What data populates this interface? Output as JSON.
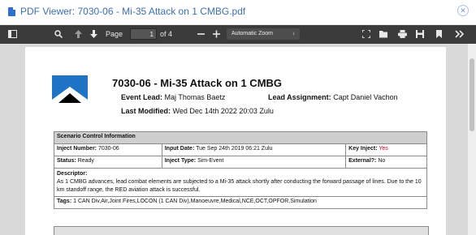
{
  "window": {
    "title": "PDF Viewer: 7030-06 - Mi-35 Attack on 1 CMBG.pdf"
  },
  "toolbar": {
    "page_label": "Page",
    "page_value": "1",
    "page_of": "of 4",
    "zoom_value": "Automatic Zoom",
    "zoom_caret": "↕",
    "icons": [
      "sidebar-toggle-icon",
      "search-icon",
      "previous-page-icon",
      "next-page-icon",
      "zoom-out-icon",
      "zoom-in-icon",
      "presentation-mode-icon",
      "open-file-icon",
      "print-icon",
      "save-icon",
      "bookmark-icon",
      "tools-icon"
    ]
  },
  "document": {
    "title": "7030-06 - Mi-35 Attack on 1 CMBG",
    "event_lead_label": "Event Lead:",
    "event_lead_value": "Maj Thomas Baetz",
    "lead_assignment_label": "Lead Assignment:",
    "lead_assignment_value": "Capt Daniel Vachon",
    "last_modified_label": "Last Modified:",
    "last_modified_value": "Wed Dec 14th 2022 20:03 Zulu",
    "scenario_control": {
      "heading": "Scenario Control Information",
      "inject_number_label": "Inject Number:",
      "inject_number_value": "7030-06",
      "input_date_label": "Input Date:",
      "input_date_value": "Tue Sep 24th 2019 06:21 Zulu",
      "key_inject_label": "Key Inject:",
      "key_inject_value": "Yes",
      "status_label": "Status:",
      "status_value": "Ready",
      "inject_type_label": "Inject Type:",
      "inject_type_value": "Sim-Event",
      "external_label": "External?:",
      "external_value": "No",
      "descriptor_label": "Descriptor:",
      "descriptor_value": "As 1 CMBG advances, lead combat elements are subjected to a Mi-35 attack shortly after conducting the forward passage of lines. Due to the 10 km standoff range, the RED aviation attack is successful.",
      "tags_label": "Tags:",
      "tags_value": "1 CAN Div,Air,Joint Fires,LOCON (1 CAN Div),Manoeuvre,Medical,NCE,OCT,OPFOR,Simulation"
    }
  },
  "colors": {
    "titlebar_text": "#3d6fb0",
    "toolbar_bg": "#3b3b3b",
    "key_inject_yes": "#d0021b",
    "logo_blue": "#1f73c4"
  }
}
